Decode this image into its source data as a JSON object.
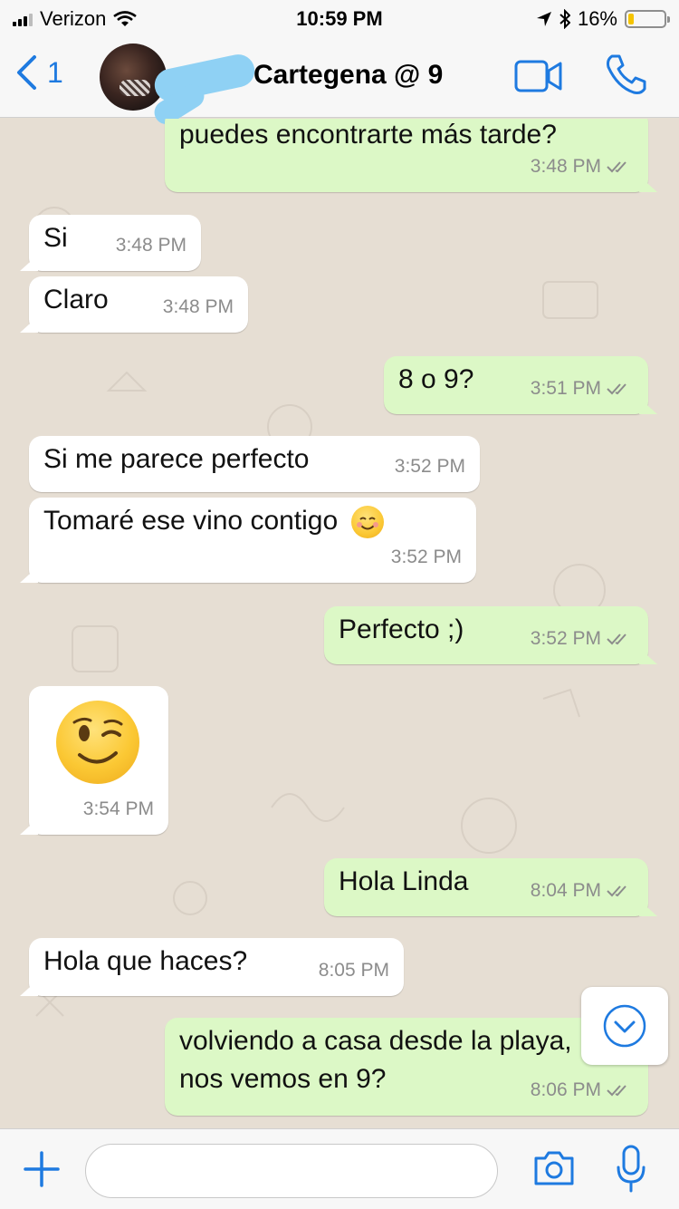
{
  "status_bar": {
    "carrier": "Verizon",
    "time": "10:59 PM",
    "battery": "16%",
    "battery_level": 0.16
  },
  "header": {
    "back_count": "1",
    "title": "Cartegena @ 9"
  },
  "messages": [
    {
      "dir": "out",
      "text": "puedes encontrarte más tarde?",
      "time": "3:48 PM"
    },
    {
      "dir": "in",
      "text": "Si",
      "time": "3:48 PM"
    },
    {
      "dir": "in",
      "text": "Claro",
      "time": "3:48 PM"
    },
    {
      "dir": "out",
      "text": "8 o 9?",
      "time": "3:51 PM"
    },
    {
      "dir": "in",
      "text": "Si me parece perfecto",
      "time": "3:52 PM"
    },
    {
      "dir": "in",
      "text": "Tomaré ese vino contigo",
      "emoji": "smiling-face-icon",
      "time": "3:52 PM"
    },
    {
      "dir": "out",
      "text": "Perfecto ;)",
      "time": "3:52 PM"
    },
    {
      "dir": "in",
      "emoji": "winking-face-icon",
      "time": "3:54 PM"
    },
    {
      "dir": "out",
      "text": "Hola Linda",
      "time": "8:04 PM"
    },
    {
      "dir": "in",
      "text": "Hola que haces?",
      "time": "8:05 PM"
    },
    {
      "dir": "out",
      "text_line1": "volviendo a casa desde la playa,",
      "text_line2": "nos vemos en 9?",
      "time": "8:06 PM"
    }
  ],
  "composer": {
    "placeholder": ""
  },
  "colors": {
    "accent": "#1e7ae0",
    "outgoing": "#dcf8c6",
    "incoming": "#ffffff",
    "background": "#e6ded3"
  }
}
